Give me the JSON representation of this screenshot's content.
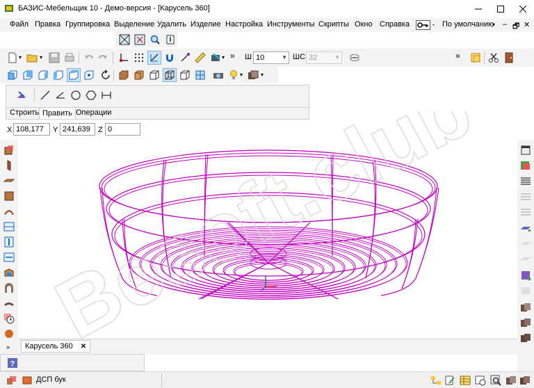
{
  "window": {
    "title": "БАЗИС-Мебельщик 10 - Демо-версия - [Карусель 360]",
    "controls": [
      "minimize",
      "maximize",
      "close"
    ]
  },
  "menu": {
    "items": [
      "Файл",
      "Правка",
      "Группировка",
      "Выделение",
      "Удалить",
      "Изделие",
      "Настройка",
      "Инструменты",
      "Скрипты",
      "Окно",
      "Справка"
    ],
    "profile": "По умолчанию"
  },
  "toolbar": {
    "w_label": "Ш",
    "w_value": "10",
    "shc_label": "ШС",
    "shc_value": "32"
  },
  "construct_tabs": [
    "Строить",
    "Править",
    "Операции"
  ],
  "coords": {
    "x_label": "X",
    "x_value": "108,177",
    "y_label": "Y",
    "y_value": "241,639",
    "z_label": "Z",
    "z_value": "0"
  },
  "document_tab": {
    "label": "Карусель 360",
    "close": "✕"
  },
  "status": {
    "material": "ДСП бук"
  },
  "watermark": "Besoft.club",
  "colors": {
    "model_stroke": "#c000c0",
    "toolbar_bg": "#f3f3f3",
    "active_button": "#cce4f7"
  }
}
